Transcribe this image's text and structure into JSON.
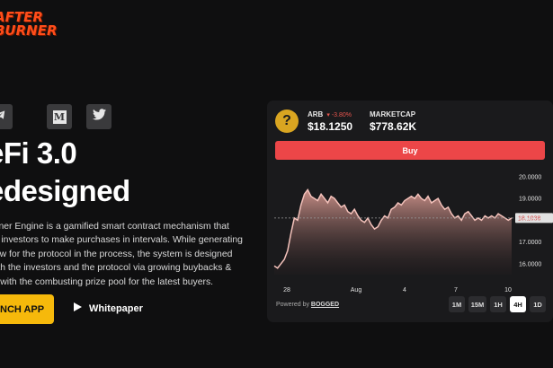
{
  "brand": {
    "logo_line1": "AFTER",
    "logo_line2": "BURNER"
  },
  "social": [
    {
      "icon": "telegram-icon"
    },
    {
      "icon": "medium-icon",
      "glyph": "M"
    },
    {
      "icon": "twitter-icon"
    }
  ],
  "hero": {
    "line1": "eFi 3.0",
    "line2": "edesigned",
    "description": [
      "rburner Engine is a gamified smart contract mechanism that",
      "izes investors to make purchases in intervals. While generating",
      "n flow for the protocol in the process, the system is designed",
      "t both the investors and the protocol via growing buybacks &",
      "ong with the combusting prize pool for the latest buyers."
    ],
    "launch_label": "NCH APP",
    "whitepaper_label": "Whitepaper"
  },
  "ticker": {
    "token_label": "ARB",
    "change": "-3.80%",
    "price": "$18.1250",
    "marketcap_label": "MARKETCAP",
    "marketcap": "$778.62K",
    "coin_glyph": "?"
  },
  "buy_label": "Buy",
  "powered": {
    "prefix": "Powered by",
    "name": "BOGGED"
  },
  "timeframes": [
    {
      "label": "1M",
      "active": false
    },
    {
      "label": "15M",
      "active": false
    },
    {
      "label": "1H",
      "active": false
    },
    {
      "label": "4H",
      "active": true
    },
    {
      "label": "1D",
      "active": false
    }
  ],
  "colors": {
    "accent": "#f6b90b",
    "buy": "#ec4648",
    "line": "#f4c2bb",
    "down": "#e8554e"
  },
  "chart_data": {
    "type": "area",
    "y_ticks": [
      "20.0000",
      "19.0000",
      "18.0000",
      "17.0000",
      "16.0000"
    ],
    "ylim": [
      15.5,
      20.2
    ],
    "x_ticks": [
      "28",
      "Aug",
      "4",
      "7",
      "10"
    ],
    "current_price_label": "18.1038",
    "current_price": 18.1038,
    "values": [
      15.9,
      15.8,
      16.0,
      16.2,
      16.6,
      17.4,
      18.1,
      18.0,
      18.7,
      19.2,
      19.4,
      19.1,
      19.0,
      18.9,
      19.2,
      19.0,
      18.8,
      19.1,
      19.0,
      18.8,
      18.6,
      18.7,
      18.4,
      18.3,
      18.5,
      18.2,
      18.0,
      17.9,
      18.1,
      17.8,
      17.6,
      17.7,
      18.0,
      18.2,
      18.1,
      18.5,
      18.6,
      18.8,
      18.7,
      18.9,
      19.0,
      19.1,
      19.0,
      19.2,
      19.0,
      18.9,
      19.1,
      18.8,
      18.9,
      19.0,
      18.7,
      18.5,
      18.6,
      18.3,
      18.1,
      18.2,
      18.0,
      18.3,
      18.4,
      18.2,
      18.0,
      18.1,
      18.0,
      18.2,
      18.1,
      18.2,
      18.1,
      18.3,
      18.2,
      18.1,
      18.0,
      18.1
    ]
  }
}
